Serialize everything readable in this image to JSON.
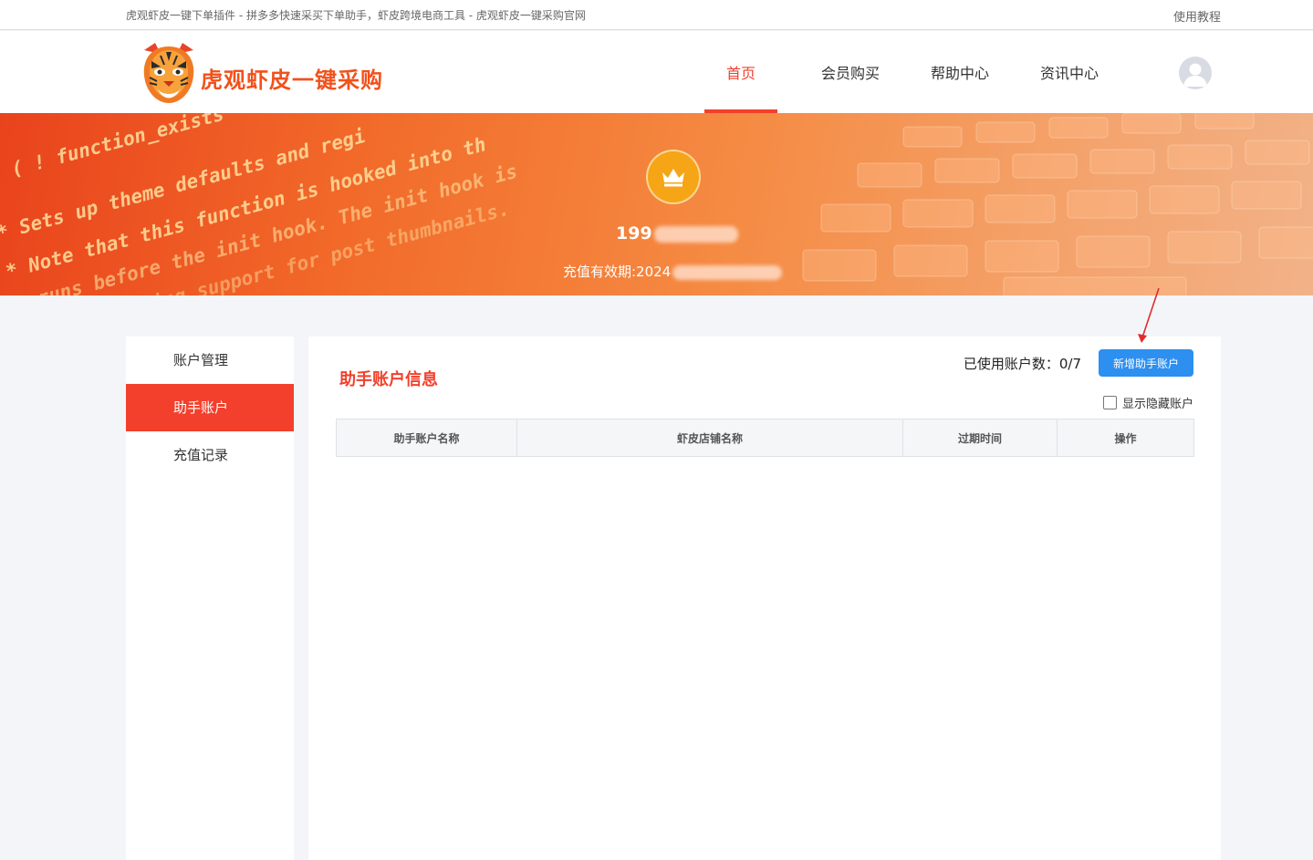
{
  "topbar": {
    "slogan": "虎观虾皮一键下单插件 - 拼多多快速采买下单助手，虾皮跨境电商工具 - 虎观虾皮一键采购官网",
    "tutorial": "使用教程"
  },
  "header": {
    "brand": "虎观虾皮一键采购",
    "nav": [
      "首页",
      "会员购买",
      "帮助中心",
      "资讯中心"
    ],
    "active_nav": "首页"
  },
  "banner": {
    "code_lines": [
      "( ! function_exists",
      "* Sets up theme defaults and regi",
      "* Note that this function is hooked into th",
      "* runs before the init hook. The init hook is",
      "* indicating support for post thumbnails."
    ],
    "phone_prefix": "199",
    "expire_label": "充值有效期:2024"
  },
  "sidebar": {
    "items": [
      "账户管理",
      "助手账户",
      "充值记录"
    ],
    "active": "助手账户"
  },
  "panel": {
    "title": "助手账户信息",
    "used_count": "已使用账户数：0/7",
    "add_button": "新增助手账户",
    "show_hidden": "显示隐藏账户",
    "columns": [
      "助手账户名称",
      "虾皮店铺名称",
      "过期时间",
      "操作"
    ]
  },
  "colors": {
    "accent": "#f2402c",
    "button": "#2d8ff0",
    "crown": "#f5a516"
  }
}
